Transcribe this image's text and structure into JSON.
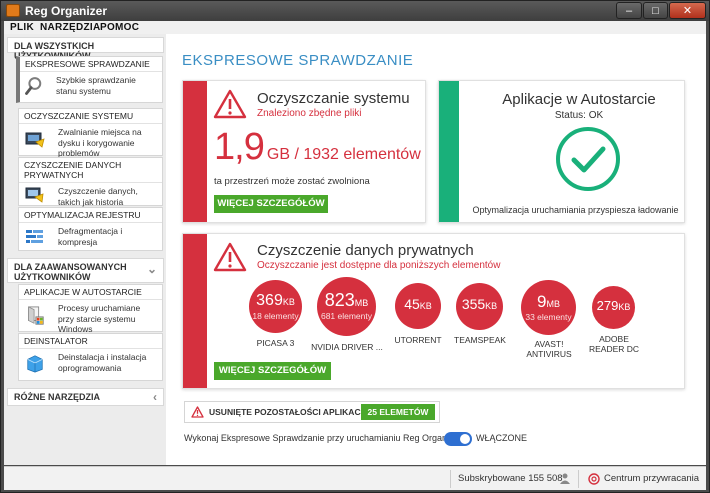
{
  "window": {
    "title": "Reg Organizer",
    "min": "–",
    "max": "□",
    "close": "✕"
  },
  "menu": [
    "PLIK",
    "NARZĘDZIA",
    "POMOC"
  ],
  "sidebar": {
    "all_users_header": "DLA WSZYSTKICH UŻYTKOWNIKÓW",
    "items": [
      {
        "title": "EKSPRESOWE SPRAWDZANIE",
        "desc": "Szybkie sprawdzanie stanu systemu",
        "icon": "magnifier-icon"
      },
      {
        "title": "OCZYSZCZANIE SYSTEMU",
        "desc": "Zwalnianie miejsca na dysku i korygowanie problemów",
        "icon": "disk-cleanup-icon"
      },
      {
        "title": "CZYSZCZENIE DANYCH PRYWATNYCH",
        "desc": "Czyszczenie danych, takich jak historia przeglądania",
        "icon": "private-data-icon"
      },
      {
        "title": "OPTYMALIZACJA REJESTRU",
        "desc": "Defragmentacja i kompresja",
        "icon": "registry-optimize-icon"
      }
    ],
    "advanced_header": "DLA ZAAWANSOWANYCH UŻYTKOWNIKÓW",
    "advanced_items": [
      {
        "title": "APLIKACJE W AUTOSTARCIE",
        "desc": "Procesy uruchamiane przy starcie systemu Windows",
        "icon": "autostart-icon"
      },
      {
        "title": "DEINSTALATOR",
        "desc": "Deinstalacja i instalacja oprogramowania",
        "icon": "uninstaller-icon"
      }
    ],
    "misc_header": "RÓŻNE NARZĘDZIA"
  },
  "main": {
    "title": "EKSPRESOWE SPRAWDZANIE",
    "system_card": {
      "heading": "Oczyszczanie systemu",
      "sub": "Znaleziono zbędne pliki",
      "big_value": "1,9",
      "big_unit": "GB / 1932 elementów",
      "note": "ta przestrzeń może zostać zwolniona",
      "button": "WIĘCEJ SZCZEGÓŁÓW"
    },
    "autostart_card": {
      "heading": "Aplikacje w Autostarcie",
      "status": "Status: OK",
      "note": "Optymalizacja uruchamiania przyspiesza ładowanie"
    },
    "private_card": {
      "heading": "Czyszczenie danych prywatnych",
      "sub": "Oczyszczanie jest dostępne dla poniższych elementów",
      "button": "WIĘCEJ SZCZEGÓŁÓW",
      "items": [
        {
          "value": "369",
          "unit": "KB",
          "count": "18 elementy",
          "name": "PICASA 3"
        },
        {
          "value": "823",
          "unit": "MB",
          "count": "681 elementy",
          "name": "NVIDIA DRIVER ..."
        },
        {
          "value": "45",
          "unit": "KB",
          "count": "",
          "name": "UTORRENT"
        },
        {
          "value": "355",
          "unit": "KB",
          "count": "",
          "name": "TEAMSPEAK"
        },
        {
          "value": "9",
          "unit": "MB",
          "count": "33 elementy",
          "name": "AVAST! ANTIVIRUS"
        },
        {
          "value": "279",
          "unit": "KB",
          "count": "",
          "name": "ADOBE READER DC"
        }
      ]
    },
    "leftovers": {
      "label": "USUNIĘTE POZOSTAŁOŚCI APLIKACJI",
      "badge": "25 ELEMETÓW"
    },
    "startup_check": {
      "label": "Wykonaj Ekspresowe Sprawdzanie przy uruchamianiu Reg Organizer",
      "state": "WŁĄCZONE"
    }
  },
  "status": {
    "subscribed": "Subskrybowane 155 508",
    "rescue": "Centrum przywracania"
  },
  "colors": {
    "accent_blue": "#3a8ec4",
    "red": "#d5303e",
    "green": "#19b07a",
    "button_green": "#4aa82b"
  }
}
